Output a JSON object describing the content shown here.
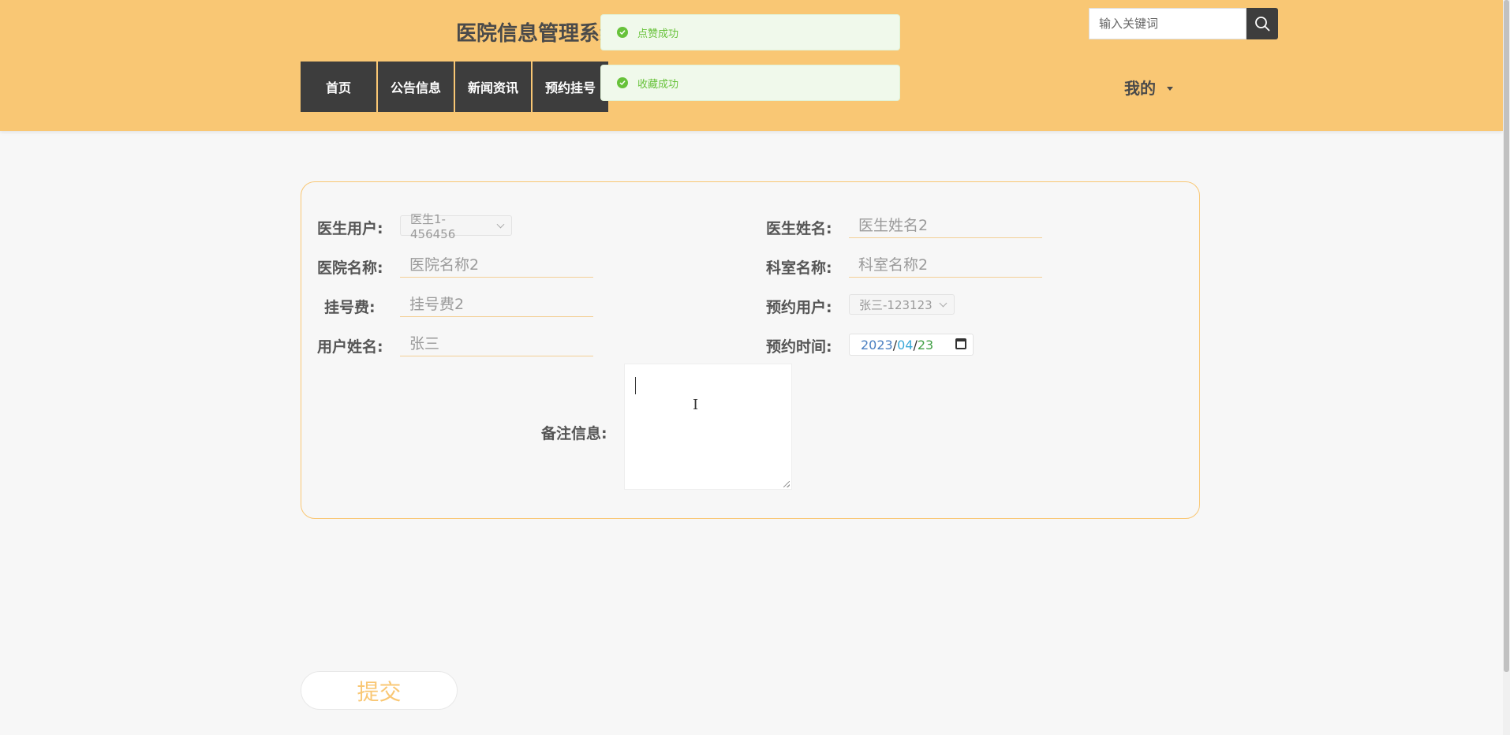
{
  "header": {
    "site_title": "医院信息管理系统",
    "nav": [
      "首页",
      "公告信息",
      "新闻资讯",
      "预约挂号"
    ],
    "search_placeholder": "输入关键词",
    "my_menu": "我的"
  },
  "toasts": [
    "点赞成功",
    "收藏成功"
  ],
  "form": {
    "doctor_user": {
      "label": "医生用户:",
      "value": "医生1-456456"
    },
    "doctor_name": {
      "label": "医生姓名:",
      "placeholder": "医生姓名2"
    },
    "hospital_name": {
      "label": "医院名称:",
      "placeholder": "医院名称2"
    },
    "department_name": {
      "label": "科室名称:",
      "placeholder": "科室名称2"
    },
    "fee": {
      "label": "挂号费:",
      "placeholder": "挂号费2"
    },
    "booking_user": {
      "label": "预约用户:",
      "value": "张三-123123"
    },
    "user_name": {
      "label": "用户姓名:",
      "placeholder": "张三"
    },
    "booking_time": {
      "label": "预约时间:",
      "year": "2023",
      "month": "04",
      "day": "23",
      "sep": "/"
    },
    "remark": {
      "label": "备注信息:",
      "value": ""
    },
    "submit": "提交"
  },
  "colors": {
    "accent": "#f9c774",
    "nav_bg": "#3d3d3d",
    "toast_text": "#67c23a"
  }
}
